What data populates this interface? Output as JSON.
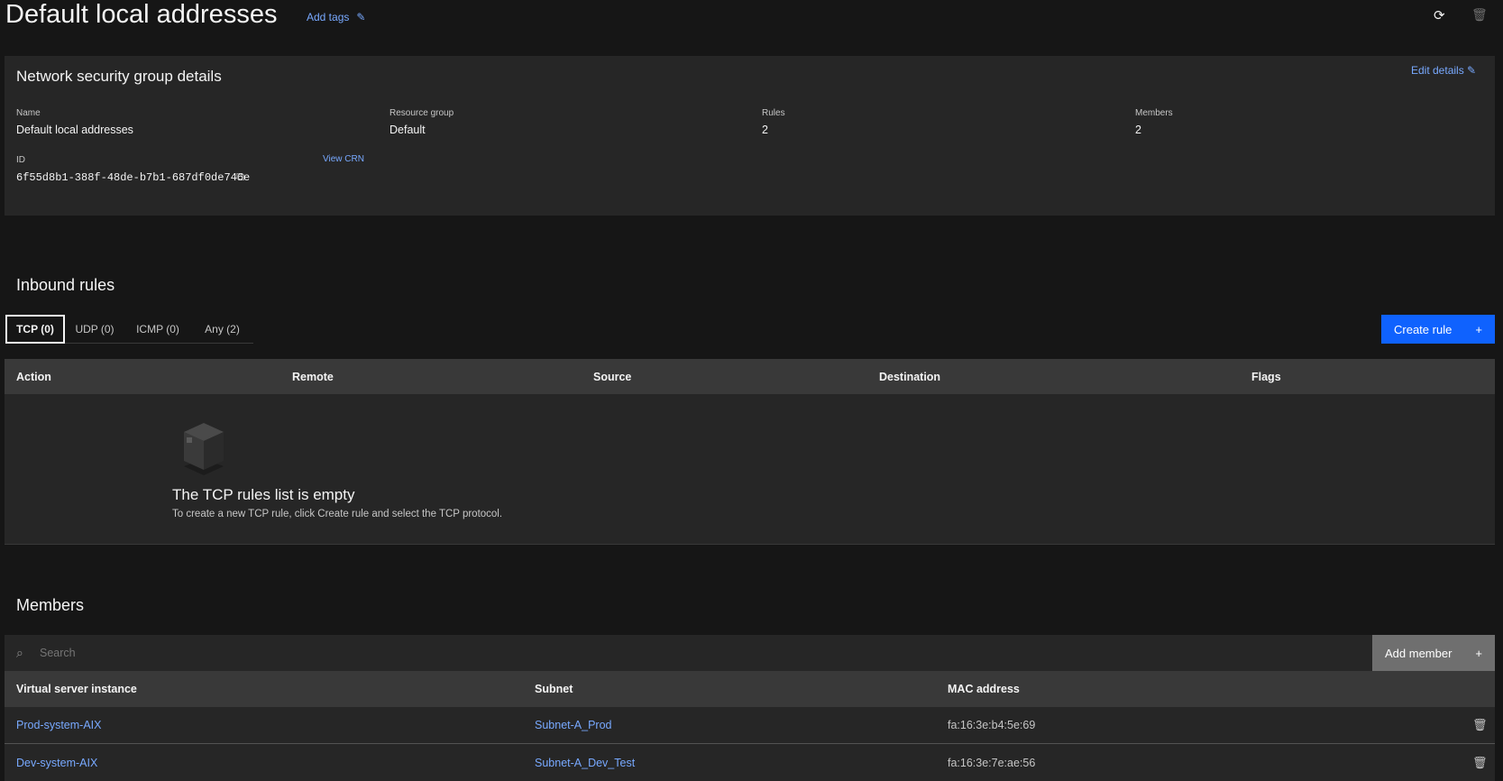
{
  "header": {
    "title": "Default local addresses",
    "add_tags": "Add tags"
  },
  "details": {
    "heading": "Network security group details",
    "edit": "Edit details",
    "fields": [
      {
        "label": "Name",
        "value": "Default local addresses"
      },
      {
        "label": "Resource group",
        "value": "Default"
      },
      {
        "label": "Rules",
        "value": "2"
      },
      {
        "label": "Members",
        "value": "2"
      }
    ],
    "id_label": "ID",
    "id_value": "6f55d8b1-388f-48de-b7b1-687df0de746e",
    "view_crn": "View CRN"
  },
  "inbound": {
    "heading": "Inbound rules",
    "tabs": [
      "TCP (0)",
      "UDP (0)",
      "ICMP (0)",
      "Any (2)"
    ],
    "create": "Create rule",
    "columns": [
      "Action",
      "Remote",
      "Source",
      "Destination",
      "Flags"
    ],
    "empty_title": "The TCP rules list is empty",
    "empty_desc": "To create a new TCP rule, click Create rule and select the TCP protocol."
  },
  "members": {
    "heading": "Members",
    "search_placeholder": "Search",
    "add": "Add member",
    "columns": [
      "Virtual server instance",
      "Subnet",
      "MAC address"
    ],
    "rows": [
      {
        "vsi": "Prod-system-AIX",
        "subnet": "Subnet-A_Prod",
        "mac": "fa:16:3e:b4:5e:69"
      },
      {
        "vsi": "Dev-system-AIX",
        "subnet": "Subnet-A_Dev_Test",
        "mac": "fa:16:3e:7e:ae:56"
      }
    ]
  },
  "colors": {
    "accent": "#0f62fe",
    "link": "#78a9ff"
  }
}
